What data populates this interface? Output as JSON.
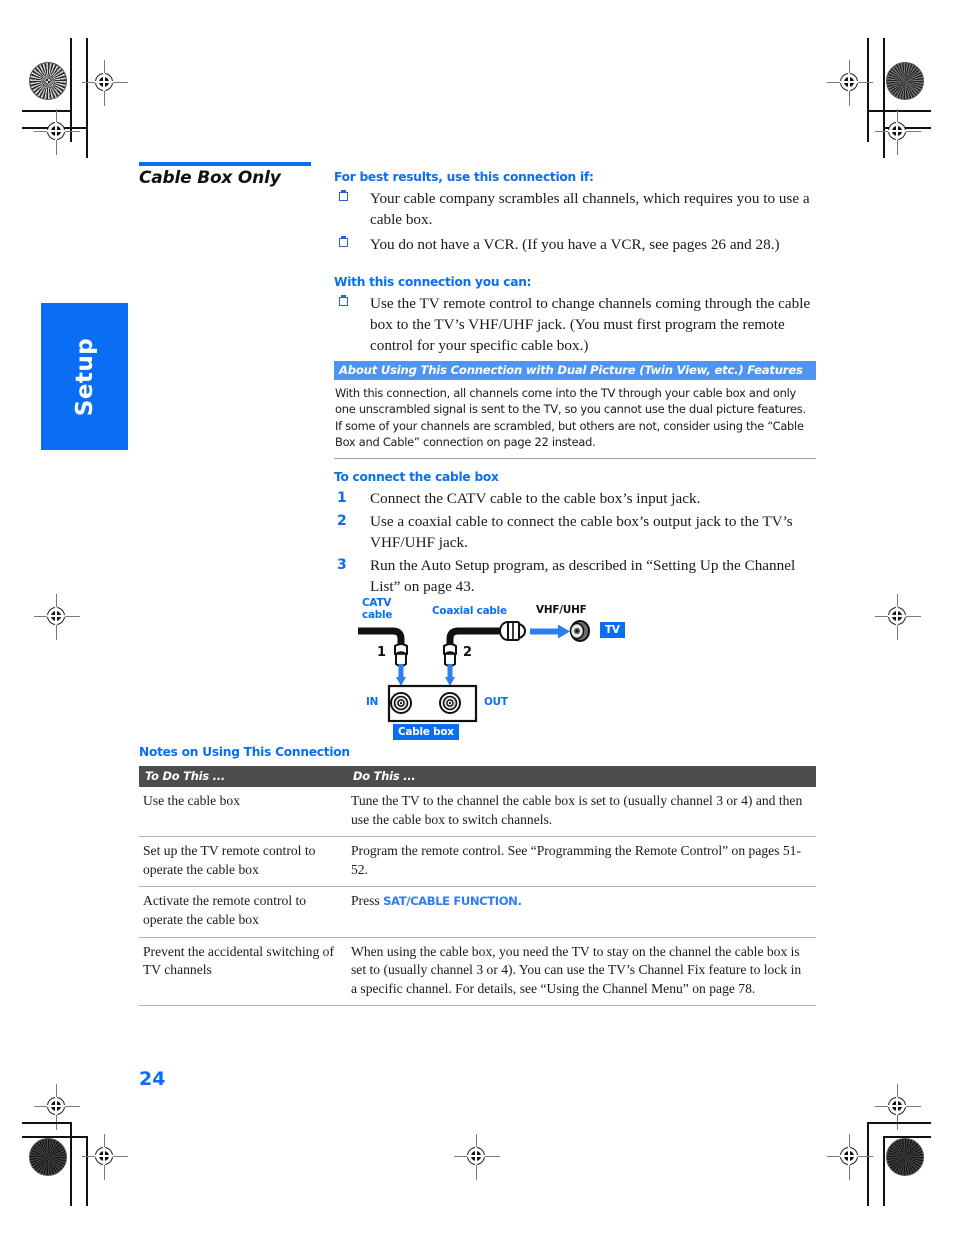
{
  "page": {
    "number": "24",
    "side_tab_label": "Setup",
    "section_title": "Cable Box Only",
    "accent_blue": "#0a6ef5",
    "callout_header_blue": "#4d95f0",
    "table_header_gray": "#4d4d4d"
  },
  "intro": {
    "best_results_heading": "For best results, use this connection if:",
    "best_results_items": [
      "Your cable company scrambles all channels, which requires you to use a cable box.",
      "You do not have a VCR. (If you have a VCR, see pages 26 and 28.)"
    ],
    "with_connection_heading": "With this connection you can:",
    "with_connection_items": [
      "Use the TV remote control to change channels coming through the cable box to the TV’s VHF/UHF jack. (You must first program the remote control for your specific cable box.)"
    ]
  },
  "callout": {
    "header": "About Using This Connection with Dual Picture (Twin View, etc.) Features",
    "body": "With this connection, all channels come into the TV through your cable box and only one unscrambled signal is sent to the TV, so you cannot use the dual picture features. If some of your channels are scrambled, but others are not, consider using the “Cable Box and Cable” connection on page 22 instead."
  },
  "steps": {
    "heading": "To connect the cable box",
    "items": [
      {
        "num": "1",
        "text": "Connect the CATV cable to the cable box’s input jack."
      },
      {
        "num": "2",
        "text": "Use a coaxial cable to connect the cable box’s output jack to the TV’s VHF/UHF jack."
      },
      {
        "num": "3",
        "text": "Run the Auto Setup program, as described in “Setting Up the Channel List” on page 43."
      }
    ]
  },
  "diagram": {
    "catv_cable_label": "CATV\ncable",
    "coaxial_cable_label": "Coaxial cable",
    "vhf_uhf_label": "VHF/UHF",
    "tv_badge": "TV",
    "cable_box_badge": "Cable box",
    "in_label": "IN",
    "out_label": "OUT",
    "plug_num_1": "1",
    "plug_num_2": "2"
  },
  "notes": {
    "heading": "Notes on Using This Connection",
    "columns": [
      "To Do This ...",
      "Do This ..."
    ],
    "rows": [
      {
        "todo": "Use the cable box",
        "do": "Tune the TV to the channel the cable box is set to (usually channel 3 or 4) and then use the cable box to switch channels."
      },
      {
        "todo": "Set up the TV remote control to operate the cable box",
        "do": "Program the remote control. See “Programming the Remote Control” on pages 51-52."
      },
      {
        "todo": "Activate the remote control to operate the cable box",
        "do_prefix": "Press ",
        "do_key": "SAT/CABLE FUNCTION.",
        "do": ""
      },
      {
        "todo": "Prevent the accidental switching of TV channels",
        "do": "When using the cable box, you need the TV to stay on the channel the cable box is set to (usually channel 3 or 4). You can use the TV’s Channel Fix feature to lock in a specific channel. For details, see “Using the Channel Menu” on page 78."
      }
    ]
  }
}
